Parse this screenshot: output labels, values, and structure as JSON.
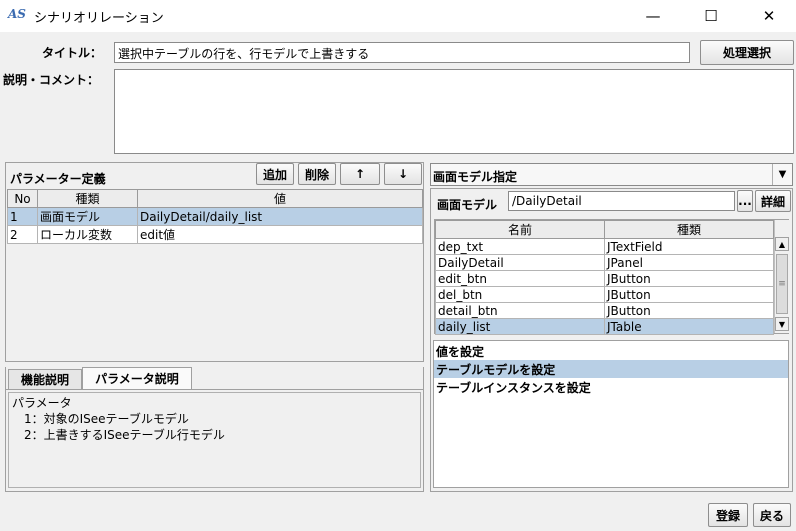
{
  "window": {
    "icon_text": "AS",
    "title": "シナリオリレーション",
    "minimize": "—",
    "maximize": "☐",
    "close": "✕"
  },
  "form": {
    "title_label": "タイトル：",
    "title_value": "選択中テーブルの行を、行モデルで上書きする",
    "process_select_button": "処理選択",
    "comment_label": "説明・コメント：",
    "comment_value": ""
  },
  "param_panel": {
    "title": "パラメーター定義",
    "add_button": "追加",
    "delete_button": "削除",
    "up_button": "↑",
    "down_button": "↓",
    "columns": [
      "No",
      "種類",
      "値"
    ],
    "rows": [
      {
        "no": "1",
        "type": "画面モデル",
        "value": "DailyDetail/daily_list",
        "selected": true
      },
      {
        "no": "2",
        "type": "ローカル変数",
        "value": "edit値",
        "selected": false
      }
    ]
  },
  "tabs": {
    "items": [
      "機能説明",
      "パラメータ説明"
    ],
    "active": 1,
    "content_lines": [
      "パラメータ",
      "　1：対象のISeeテーブルモデル",
      "　2：上書きするISeeテーブル行モデル"
    ]
  },
  "model_panel": {
    "dropdown_value": "画面モデル指定",
    "model_label": "画面モデル",
    "model_value": "/DailyDetail",
    "browse_button": "...",
    "detail_button": "詳細",
    "columns": [
      "名前",
      "種類"
    ],
    "rows": [
      {
        "name": "dep_txt",
        "type": "JTextField",
        "selected": false
      },
      {
        "name": "DailyDetail",
        "type": "JPanel",
        "selected": false
      },
      {
        "name": "edit_btn",
        "type": "JButton",
        "selected": false
      },
      {
        "name": "del_btn",
        "type": "JButton",
        "selected": false
      },
      {
        "name": "detail_btn",
        "type": "JButton",
        "selected": false
      },
      {
        "name": "daily_list",
        "type": "JTable",
        "selected": true
      }
    ]
  },
  "value_list": {
    "items": [
      {
        "label": "値を設定",
        "selected": false
      },
      {
        "label": "テーブルモデルを設定",
        "selected": true
      },
      {
        "label": "テーブルインスタンスを設定",
        "selected": false
      }
    ]
  },
  "footer": {
    "register_button": "登録",
    "back_button": "戻る"
  },
  "colors": {
    "selection": "#b8cfe5",
    "background": "#f0f0f0"
  }
}
